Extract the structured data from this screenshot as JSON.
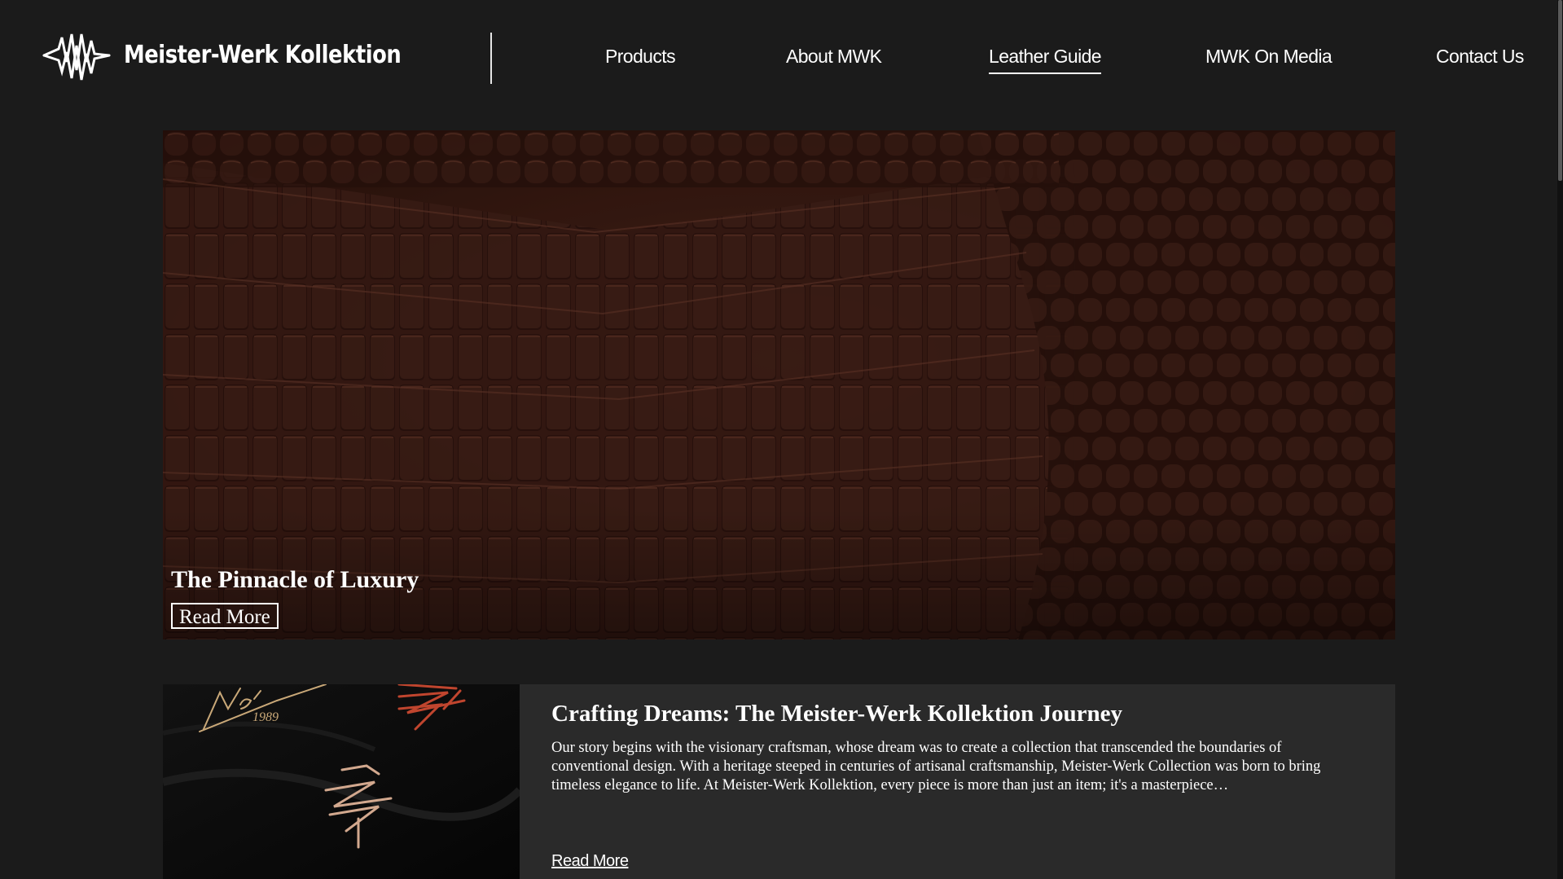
{
  "brand": {
    "logo_icon": "mwk-monogram-logo",
    "name": "Meister-Werk Kollektion"
  },
  "nav": {
    "items": [
      {
        "label": "Products"
      },
      {
        "label": "About MWK"
      },
      {
        "label": "Leather Guide",
        "active": true
      },
      {
        "label": "MWK On Media"
      },
      {
        "label": "Contact Us"
      }
    ]
  },
  "hero": {
    "title": "The Pinnacle of Luxury",
    "button_label": "Read More",
    "image": "crocodile-leather-texture"
  },
  "article": {
    "image": "embroidered-logos-on-black-fabric",
    "title": "Crafting Dreams: The Meister-Werk Kollektion Journey",
    "excerpt": "Our story begins with the visionary craftsman, whose dream was to create a collection that transcended the boundaries of conventional design. With a heritage steeped in centuries of artisanal craftsmanship, Meister-Werk Collection was born to bring timeless elegance to life. At Meister-Werk Kollektion, every piece is more than just an item; it's a masterpiece…",
    "link_label": "Read More"
  },
  "colors": {
    "page_background": "#1b1b1b",
    "card_background": "#2a2a2a",
    "text": "#ffffff",
    "leather": "#3a1d16"
  }
}
